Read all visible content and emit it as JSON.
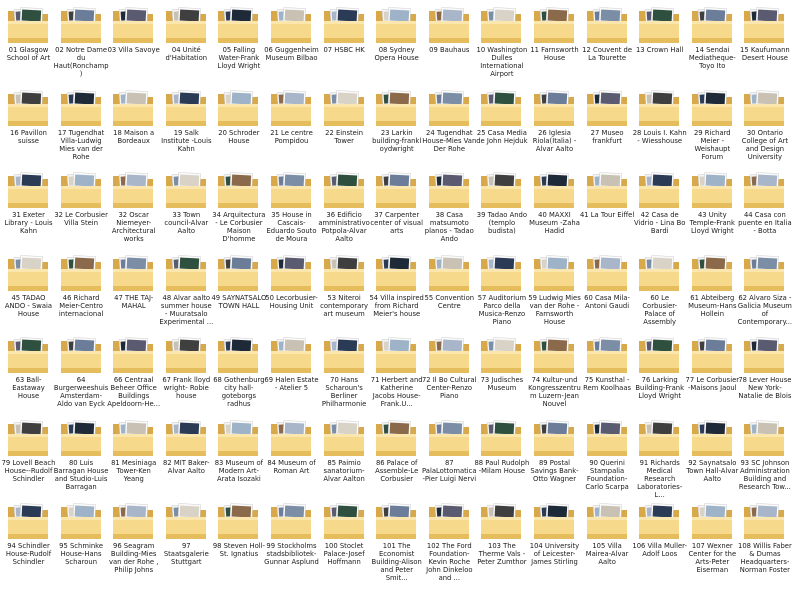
{
  "window": {
    "view": "folder-icon-grid"
  },
  "colors": {
    "folder_back": "#d8a94a",
    "folder_front": "#f6d98a",
    "folder_front_dark": "#e6bd5c",
    "label_text": "#1a1a1a"
  },
  "folder_icon": "folder-with-photos-icon",
  "folders": [
    "01 Glasgow School of Art",
    "02 Notre Dame du Haut(Ronchamp)",
    "03 Villa Savoye",
    "04 Unité d'Habitation",
    "05 Falling Water-Frank Lloyd Wright",
    "06 Guggenheim Museum Bilbao",
    "07 HSBC HK",
    "08 Sydney Opera House",
    "09 Bauhaus",
    "10 Washington Dulles International Airport",
    "11 Farnsworth House",
    "12 Couvent de La Tourette",
    "13 Crown Hall",
    "14 Sendai Mediatheque-Toyo Ito",
    "15 Kaufumann Desert House",
    "16 Pavillon suisse",
    "17 Tugendhat Villa-Ludwig Mies van der Rohe",
    "18 Maison a Bordeaux",
    "19 Salk Institute -Louis Kahn",
    "20 Schroder House",
    "21 Le centre Pompidou",
    "22 Einstein Tower",
    "23 Larkin building-frankl oydwright",
    "24 Tugendhat House-Mies Van Der Rohe",
    "25 Casa Media de John Hejduk",
    "26 Iglesia Riola(Italia) - Alvar Aalto",
    "27 Museo frankfurt",
    "28 Louis I. Kahn - Wiesshouse",
    "29 Richard Meier - Weishaupt Forum",
    "30 Ontario College of Art and Design University",
    "31 Exeter Library - Louis Kahn",
    "32 Le Corbusier Villa Stein",
    "32 Oscar Niemeyer-Architectural works",
    "33 Town council-Alvar Aalto",
    "34 Arquitectura - Le Corbusier Maison D'homme",
    "35 House in Cascais-Eduardo Souto de Moura",
    "36 Edificio amministrativo Potpola-Alvar Aalto",
    "37 Carpenter center of visual arts",
    "38 Casa matsumoto planos - Tadao Ando",
    "39 Tadao Ando (templo budista)",
    "40 MAXXI Museum -Zaha Hadid",
    "41 La Tour Eiffel",
    "42 Casa de Vidrio - Lina Bo Bardi",
    "43 Unity Temple-Frank Lloyd Wright",
    "44 Casa con puente en Italia - Botta",
    "45 TADAO ANDO - Swaia House",
    "46 Richard Meier-Centro internacional",
    "47 THE TAJ-MAHAL",
    "48 Alvar aalto summer house - Muuratsalo Experimental ...",
    "49 SAYNÄTSALO TOWN HALL",
    "50 Lecorbusier-Housing Unit",
    "53 Niteroi contemporary art museum",
    "54 Villa inspired from Richard Meier's house",
    "55 Convention Centre",
    "57 Auditorium Parco della Musica-Renzo Piano",
    "59 Ludwig Mies van der Rohe - Farnsworth House",
    "60 Casa Mila-Antoni Gaudi",
    "60 Le Corbusier-Palace of Assembly",
    "61 Abteiberg Museum-Hans Hollein",
    "62 Alvaro Siza - Galicia Museum of Contemporary...",
    "63 Ball-Eastaway House",
    "64 Burgerweeshuis Amsterdam-Aldo van Eyck",
    "66 Centraal Beheer Office Buildings Apeldoorn-He...",
    "67 Frank lloyd wright- Robie house",
    "68 Gothenburg city hall-goteborgs radhus",
    "69 Halen Estate - Atelier 5",
    "70 Hans Scharoun's Berliner Philharmonie",
    "71 Herbert and Katherine Jacobs House-Frank.U...",
    "72 Il Bo Cultural Center-Renzo Piano",
    "73 Judisches Museum",
    "74 Kultur-und Kongresszentrum Luzern-Jean Nouvel",
    "75 Kunsthal -Rem Koolhaas",
    "76 Larking Building-Frank Lloyd Wright",
    "77 Le Corbusier -Maisons Jaoul",
    "78 Lever House New York-Natalie de Blois",
    "79 Lovell Beach House--Rudolf Schindler",
    "80 Luis Barragan House and Studio-Luis Barragan",
    "81 Mesiniaga Tower-Ken Yeang",
    "82 MIT Baker-Alvar Aalto",
    "83 Museum of Modern Art-Arata Isozaki",
    "84 Museum of Roman Art",
    "85 Paimio sanatorium-Alvar Aalton",
    "86 Palace of Assemble-Le Corbusier",
    "87 PalaLottomatica-Pier Luigi Nervi",
    "88 Paul Rudolph -Milam House",
    "89 Postal Savings Bank-Otto Wagner",
    "90 Querini Stampalia Foundation-Carlo Scarpa",
    "91 Richards Medical Research Laboratories-L...",
    "92 Saynatsalo Town Hall-Alvar Aalto",
    "93 SC Johnson Administration Building and Research Tow...",
    "94 Schindler House-Rudolf Schindler",
    "95 Schminke House-Hans Scharoun",
    "96 Seagram Building-Mies van der Rohe , Philip Johns",
    "97 Staatsgalerie Stuttgart",
    "98 Steven Holl-St. Ignatius",
    "99 Stockholms stadsbibliotek-Gunnar Asplund",
    "100 Stoclet Palace-Josef Hoffmann",
    "101 The Economist Building-Alison and Peter Smit...",
    "102 The Ford Foundation-Kevin Roche John Dinkeloo and ...",
    "103 The Therme Vals - Peter Zumthor",
    "104 University of Leicester-James Stirling",
    "105 Villa Mairea-Alvar Aalto",
    "106 Villa Muller-Adolf Loos",
    "107 Wexner Center for the Arts-Peter Eiserman",
    "108 Willis Faber & Dumas Headquarters-Norman Foster"
  ]
}
